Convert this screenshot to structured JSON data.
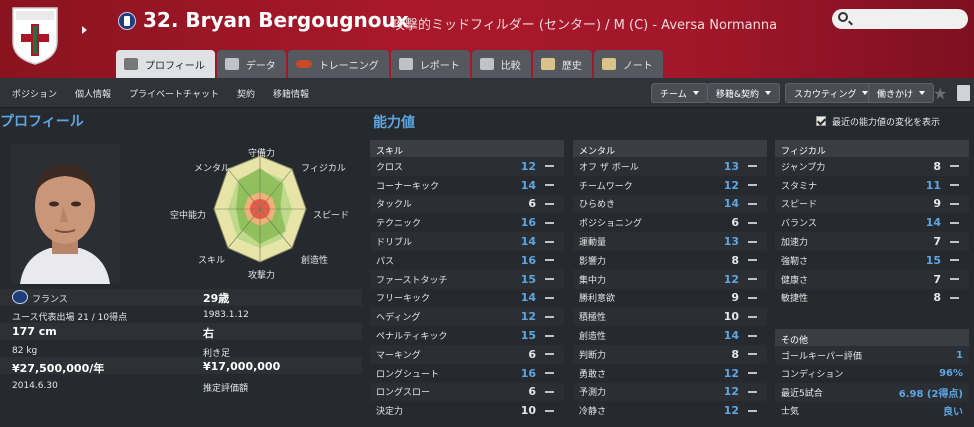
{
  "header": {
    "player_name": "32. Bryan Bergougnoux",
    "subtitle": "攻撃的ミッドフィルダー (センター) / M (C) - Aversa Normanna",
    "search_placeholder": ""
  },
  "tabs": [
    {
      "label": "プロフィール",
      "icon": "profile-icon",
      "active": true
    },
    {
      "label": "データ",
      "icon": "stats-icon"
    },
    {
      "label": "トレーニング",
      "icon": "training-icon"
    },
    {
      "label": "レポート",
      "icon": "report-icon"
    },
    {
      "label": "比較",
      "icon": "compare-icon"
    },
    {
      "label": "歴史",
      "icon": "history-icon"
    },
    {
      "label": "ノート",
      "icon": "notes-icon"
    }
  ],
  "subnav": {
    "links": [
      "ポジション",
      "個人情報",
      "プライベートチャット",
      "契約",
      "移籍情報"
    ],
    "dropdowns": [
      "チーム",
      "移籍&契約",
      "スカウティング",
      "働きかけ"
    ]
  },
  "profile": {
    "title": "プロフィール",
    "radar_labels": [
      "守備力",
      "フィジカル",
      "スピード",
      "創造性",
      "攻撃力",
      "スキル",
      "空中能力",
      "メンタル"
    ],
    "nation": "フランス",
    "age": "29歳",
    "caps_label": "ユース代表出場 21 / 10得点",
    "birthdate": "1983.1.12",
    "height": "177 cm",
    "foot": "右",
    "weight": "82 kg",
    "foot_label": "利き足",
    "wage": "¥27,500,000/年",
    "value": "¥17,000,000",
    "contract_end": "2014.6.30",
    "value_label": "推定評価額"
  },
  "attributes": {
    "title": "能力値",
    "checkbox_label": "最近の能力値の変化を表示",
    "checkbox_checked": true,
    "skill": {
      "header": "スキル",
      "rows": [
        {
          "name": "クロス",
          "value": "12",
          "hi": true
        },
        {
          "name": "コーナーキック",
          "value": "14",
          "hi": true
        },
        {
          "name": "タックル",
          "value": "6",
          "hi": false
        },
        {
          "name": "テクニック",
          "value": "16",
          "hi": true
        },
        {
          "name": "ドリブル",
          "value": "14",
          "hi": true
        },
        {
          "name": "パス",
          "value": "16",
          "hi": true
        },
        {
          "name": "ファーストタッチ",
          "value": "15",
          "hi": true
        },
        {
          "name": "フリーキック",
          "value": "14",
          "hi": true
        },
        {
          "name": "ヘディング",
          "value": "12",
          "hi": true
        },
        {
          "name": "ペナルティキック",
          "value": "15",
          "hi": true
        },
        {
          "name": "マーキング",
          "value": "6",
          "hi": false
        },
        {
          "name": "ロングシュート",
          "value": "16",
          "hi": true
        },
        {
          "name": "ロングスロー",
          "value": "6",
          "hi": false
        },
        {
          "name": "決定力",
          "value": "10",
          "hi": false
        }
      ]
    },
    "mental": {
      "header": "メンタル",
      "rows": [
        {
          "name": "オフ ザ ボール",
          "value": "13",
          "hi": true
        },
        {
          "name": "チームワーク",
          "value": "12",
          "hi": true
        },
        {
          "name": "ひらめき",
          "value": "14",
          "hi": true
        },
        {
          "name": "ポジショニング",
          "value": "6",
          "hi": false
        },
        {
          "name": "運動量",
          "value": "13",
          "hi": true
        },
        {
          "name": "影響力",
          "value": "8",
          "hi": false
        },
        {
          "name": "集中力",
          "value": "12",
          "hi": true
        },
        {
          "name": "勝利意欲",
          "value": "9",
          "hi": false
        },
        {
          "name": "積極性",
          "value": "10",
          "hi": false
        },
        {
          "name": "創造性",
          "value": "14",
          "hi": true
        },
        {
          "name": "判断力",
          "value": "8",
          "hi": false
        },
        {
          "name": "勇敢さ",
          "value": "12",
          "hi": true
        },
        {
          "name": "予測力",
          "value": "12",
          "hi": true
        },
        {
          "name": "冷静さ",
          "value": "12",
          "hi": true
        }
      ]
    },
    "physical": {
      "header": "フィジカル",
      "rows": [
        {
          "name": "ジャンプ力",
          "value": "8",
          "hi": false
        },
        {
          "name": "スタミナ",
          "value": "11",
          "hi": true
        },
        {
          "name": "スピード",
          "value": "9",
          "hi": false
        },
        {
          "name": "バランス",
          "value": "14",
          "hi": true
        },
        {
          "name": "加速力",
          "value": "7",
          "hi": false
        },
        {
          "name": "強靭さ",
          "value": "15",
          "hi": true
        },
        {
          "name": "健康さ",
          "value": "7",
          "hi": false
        },
        {
          "name": "敏捷性",
          "value": "8",
          "hi": false
        }
      ]
    },
    "other": {
      "header": "その他",
      "rows": [
        {
          "name": "ゴールキーパー評価",
          "value": "1"
        },
        {
          "name": "コンディション",
          "value": "96%"
        },
        {
          "name": "最近5試合",
          "value": "6.98 (2得点)"
        },
        {
          "name": "士気",
          "value": "良い"
        }
      ]
    }
  },
  "colors": {
    "accent": "#5ea6e3",
    "header_red": "#a8182a"
  }
}
